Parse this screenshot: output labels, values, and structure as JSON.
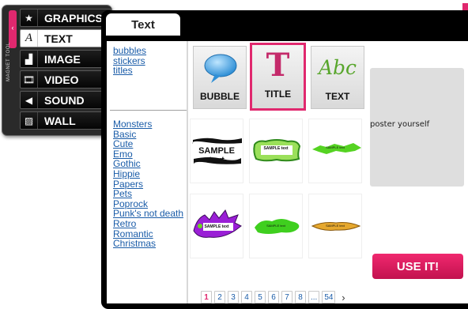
{
  "toolbar": {
    "vertical_label": "MAGNET TOOL",
    "grip_glyph": "‹",
    "items": [
      {
        "label": "GRAPHICS",
        "icon": "star-icon",
        "glyph": "★"
      },
      {
        "label": "TEXT",
        "icon": "text-icon",
        "glyph": "A"
      },
      {
        "label": "IMAGE",
        "icon": "image-icon",
        "glyph": "▟"
      },
      {
        "label": "VIDEO",
        "icon": "video-icon",
        "glyph": "🎞"
      },
      {
        "label": "SOUND",
        "icon": "speaker-icon",
        "glyph": "◀"
      },
      {
        "label": "WALL",
        "icon": "wall-icon",
        "glyph": "▨"
      }
    ]
  },
  "panel": {
    "tab_label": "Text",
    "types": [
      "bubbles",
      "stickers",
      "titles"
    ],
    "themes": [
      "Monsters",
      "Basic",
      "Cute",
      "Emo",
      "Gothic",
      "Hippie",
      "Papers",
      "Pets",
      "Poprock",
      "Punk's not death",
      "Retro",
      "Romantic",
      "Christmas"
    ],
    "categories_big": [
      {
        "label": "BUBBLE",
        "icon": "speech-bubble-icon"
      },
      {
        "label": "TITLE",
        "icon": "title-t-icon",
        "glyph": "T"
      },
      {
        "label": "TEXT",
        "icon": "abc-text-icon",
        "glyph": "Abc"
      }
    ],
    "samples": [
      {
        "text": "SAMPLE text",
        "style": "black-brush"
      },
      {
        "text": "SAMPLE text",
        "style": "green-outline"
      },
      {
        "text": "SAMPLE text",
        "style": "green-splash"
      },
      {
        "text": "SAMPLE text",
        "style": "purple-monster"
      },
      {
        "text": "SAMPLE text",
        "style": "green-blob"
      },
      {
        "text": "SAMPLE text",
        "style": "gold-banner"
      }
    ],
    "preview_text": "poster yourself",
    "use_button": "USE IT!",
    "pages": [
      "1",
      "2",
      "3",
      "4",
      "5",
      "6",
      "7",
      "8",
      "...",
      "54"
    ],
    "current_page": "1",
    "next_glyph": "›"
  },
  "colors": {
    "accent": "#e0286e",
    "link": "#1a5ca8",
    "bar": "#000000"
  }
}
